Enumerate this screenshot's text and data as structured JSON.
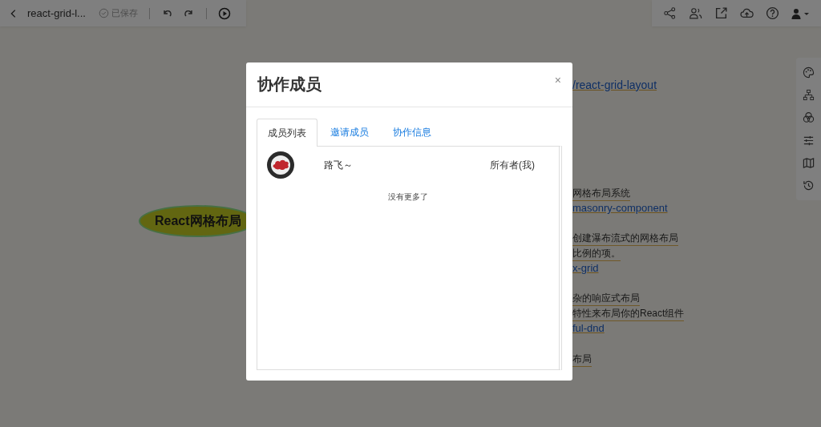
{
  "toolbar": {
    "title": "react-grid-l...",
    "save_status": "已保存"
  },
  "mindmap": {
    "root": "React网格布局",
    "items": [
      {
        "kind": "link",
        "text": "/react-grid-layout"
      },
      {
        "kind": "text",
        "text": "网格布局系统"
      },
      {
        "kind": "link",
        "text": "masonry-component"
      },
      {
        "kind": "text",
        "text": "创建瀑布流式的网格布局"
      },
      {
        "kind": "text",
        "text": "比例的项。"
      },
      {
        "kind": "link",
        "text": "x-grid"
      },
      {
        "kind": "text",
        "text": "杂的响应式布局"
      },
      {
        "kind": "text",
        "text": "特性来布局你的React组件"
      },
      {
        "kind": "link",
        "text": "ful-dnd"
      },
      {
        "kind": "text",
        "text": "布局"
      }
    ]
  },
  "dialog": {
    "title": "协作成员",
    "close": "×",
    "tabs": [
      {
        "label": "成员列表",
        "selected": true
      },
      {
        "label": "邀请成员",
        "selected": false
      },
      {
        "label": "协作信息",
        "selected": false
      }
    ],
    "members": [
      {
        "name": "路飞～",
        "role": "所有者(我)"
      }
    ],
    "end_note": "没有更多了"
  }
}
